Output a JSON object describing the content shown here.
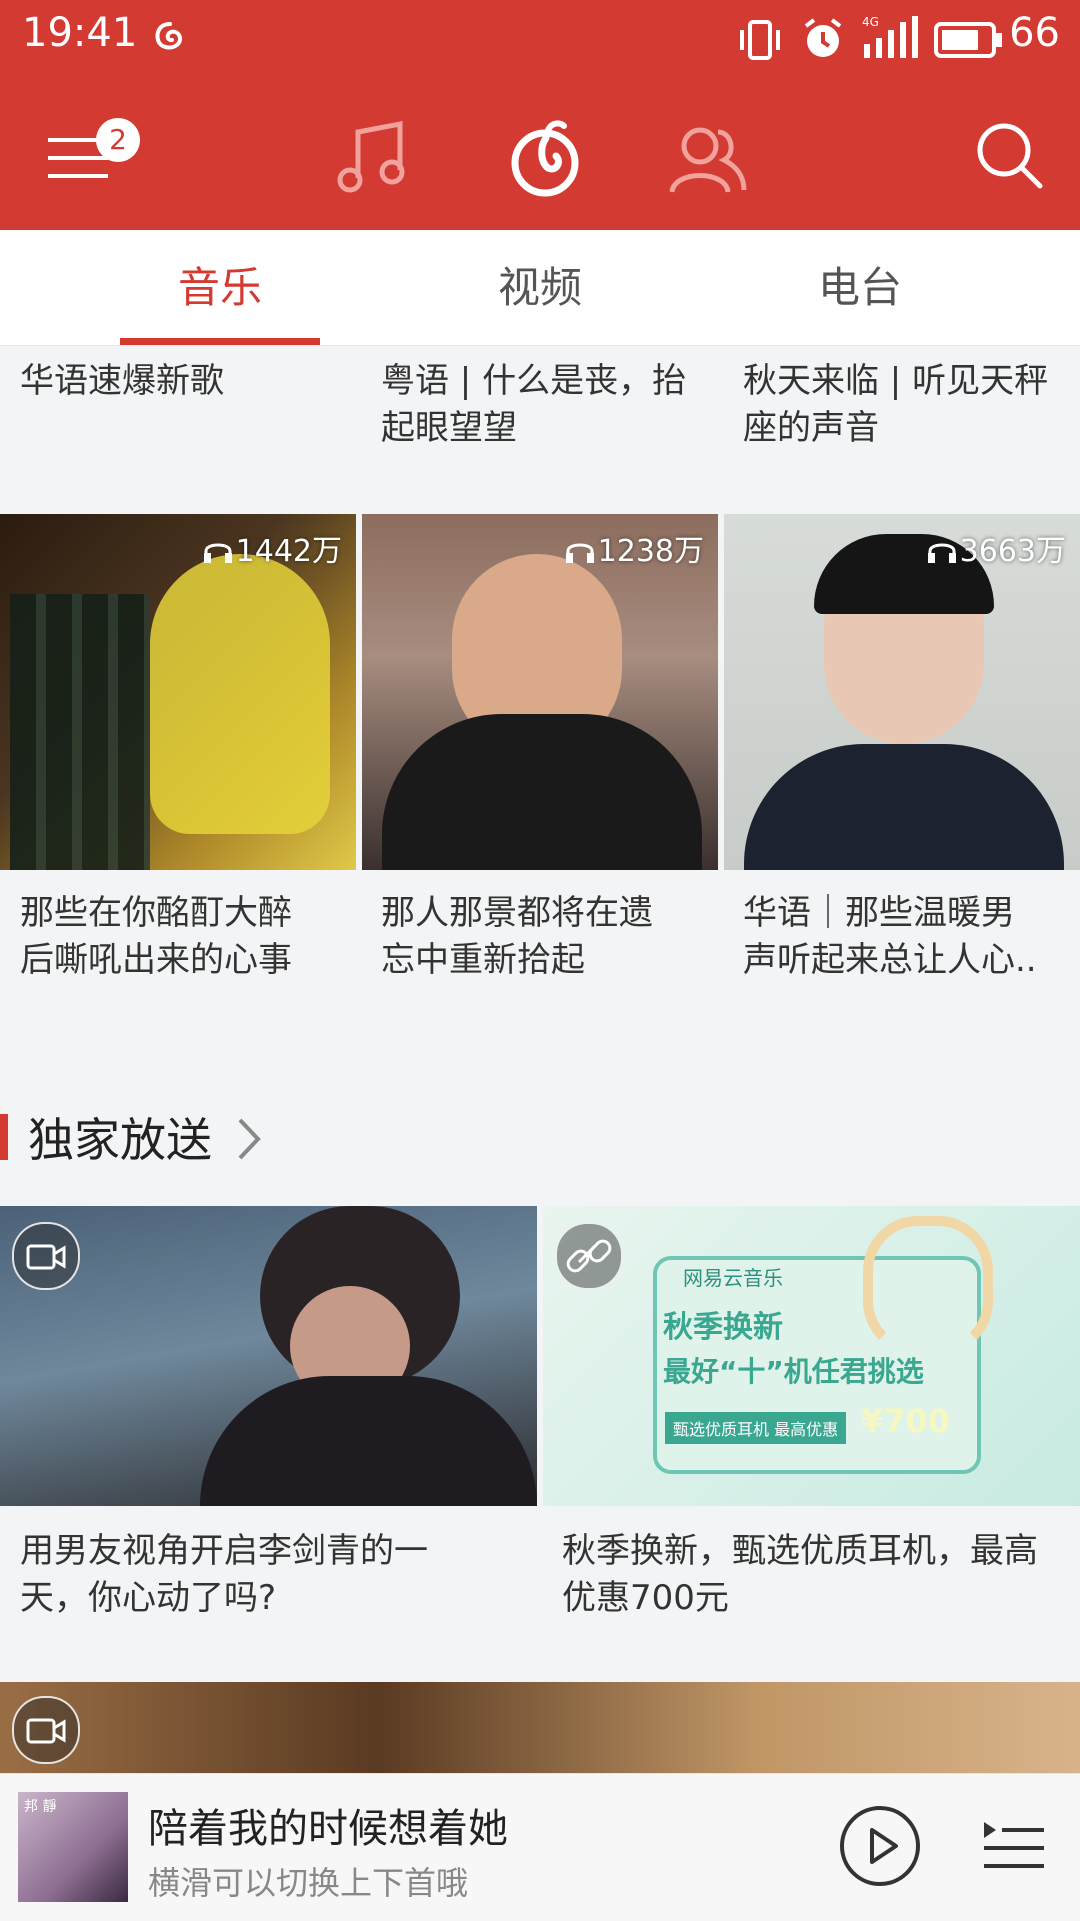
{
  "status_bar": {
    "time": "19:41",
    "signal": "4G",
    "battery": "66",
    "icons": [
      "netease-cloud-icon",
      "vibrate-icon",
      "alarm-icon",
      "signal-icon",
      "battery-icon"
    ]
  },
  "header": {
    "menu_badge": "2",
    "icons": [
      "menu-icon",
      "music-note-icon",
      "netease-logo-icon",
      "friends-icon",
      "search-icon"
    ]
  },
  "tabs": [
    {
      "label": "音乐",
      "active": true
    },
    {
      "label": "视频",
      "active": false
    },
    {
      "label": "电台",
      "active": false
    }
  ],
  "top_row": [
    {
      "title_line1": "华语速爆新歌",
      "title_line2": ""
    },
    {
      "title_line1": "粤语 | 什么是丧，抬",
      "title_line2": "起眼望望"
    },
    {
      "title_line1": "秋天来临 | 听见天秤",
      "title_line2": "座的声音"
    }
  ],
  "playlists": [
    {
      "play_count": "1442万",
      "title_line1": "那些在你酩酊大醉",
      "title_line2": "后嘶吼出来的心事"
    },
    {
      "play_count": "1238万",
      "title_line1": "那人那景都将在遗",
      "title_line2": "忘中重新拾起"
    },
    {
      "play_count": "3663万",
      "title_line1": "华语｜那些温暖男",
      "title_line2": "声听起来总让人心.."
    }
  ],
  "exclusive": {
    "title": "独家放送",
    "items": [
      {
        "badge_icon": "video-camera-icon",
        "title_line1": "用男友视角开启李剑青的一",
        "title_line2": "天，你心动了吗?"
      },
      {
        "badge_icon": "link-icon",
        "title_line1": "秋季换新，甄选优质耳机，最高",
        "title_line2": "优惠700元",
        "ad": {
          "brand": "网易云音乐",
          "line1": "秋季换新",
          "line2": "最好“十”机任君挑选",
          "tag": "甄选优质耳机  最高优惠",
          "price": "¥700"
        }
      }
    ]
  },
  "player": {
    "song": "陪着我的时候想着她",
    "hint": "横滑可以切换上下首哦",
    "cover_text": "邦 靜"
  }
}
